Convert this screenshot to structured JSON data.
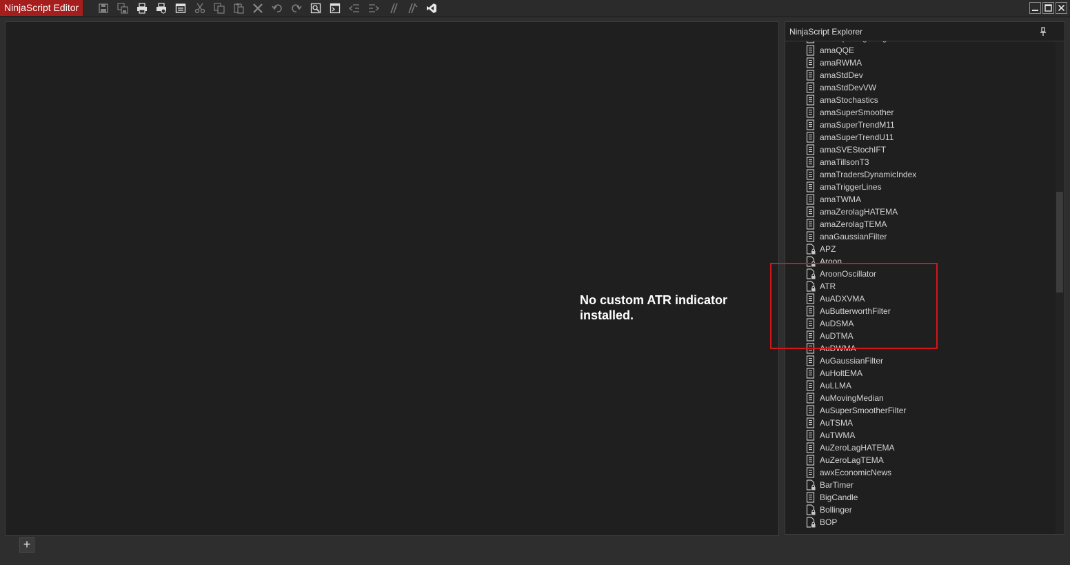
{
  "window": {
    "title": "NinjaScript Editor"
  },
  "toolbar": {
    "buttons": [
      {
        "name": "save-icon",
        "enabled": false
      },
      {
        "name": "save-all-icon",
        "enabled": false
      },
      {
        "name": "print-icon",
        "enabled": true
      },
      {
        "name": "print-preview-icon",
        "enabled": true
      },
      {
        "name": "properties-icon",
        "enabled": true
      },
      {
        "name": "cut-icon",
        "enabled": false
      },
      {
        "name": "copy-icon",
        "enabled": false
      },
      {
        "name": "paste-icon",
        "enabled": false
      },
      {
        "name": "delete-icon",
        "enabled": false
      },
      {
        "name": "undo-icon",
        "enabled": false
      },
      {
        "name": "redo-icon",
        "enabled": false
      },
      {
        "name": "find-icon",
        "enabled": true
      },
      {
        "name": "compile-icon",
        "enabled": true
      },
      {
        "name": "outdent-icon",
        "enabled": false
      },
      {
        "name": "indent-icon",
        "enabled": false
      },
      {
        "name": "comment-icon",
        "enabled": false
      },
      {
        "name": "uncomment-icon",
        "enabled": false
      },
      {
        "name": "visual-studio-icon",
        "enabled": true
      }
    ]
  },
  "annotation": {
    "text": "No custom ATR indicator installed."
  },
  "explorer": {
    "title": "NinjaScript Explorer",
    "items": [
      {
        "label": "amaOpeningRange",
        "locked": false
      },
      {
        "label": "amaQQE",
        "locked": false
      },
      {
        "label": "amaRWMA",
        "locked": false
      },
      {
        "label": "amaStdDev",
        "locked": false
      },
      {
        "label": "amaStdDevVW",
        "locked": false
      },
      {
        "label": "amaStochastics",
        "locked": false
      },
      {
        "label": "amaSuperSmoother",
        "locked": false
      },
      {
        "label": "amaSuperTrendM11",
        "locked": false
      },
      {
        "label": "amaSuperTrendU11",
        "locked": false
      },
      {
        "label": "amaSVEStochIFT",
        "locked": false
      },
      {
        "label": "amaTillsonT3",
        "locked": false
      },
      {
        "label": "amaTradersDynamicIndex",
        "locked": false
      },
      {
        "label": "amaTriggerLines",
        "locked": false
      },
      {
        "label": "amaTWMA",
        "locked": false
      },
      {
        "label": "amaZerolagHATEMA",
        "locked": false
      },
      {
        "label": "amaZerolagTEMA",
        "locked": false
      },
      {
        "label": "anaGaussianFilter",
        "locked": false
      },
      {
        "label": "APZ",
        "locked": true
      },
      {
        "label": "Aroon",
        "locked": true
      },
      {
        "label": "AroonOscillator",
        "locked": true
      },
      {
        "label": "ATR",
        "locked": true
      },
      {
        "label": "AuADXVMA",
        "locked": false
      },
      {
        "label": "AuButterworthFilter",
        "locked": false
      },
      {
        "label": "AuDSMA",
        "locked": false
      },
      {
        "label": "AuDTMA",
        "locked": false
      },
      {
        "label": "AuDWMA",
        "locked": false
      },
      {
        "label": "AuGaussianFilter",
        "locked": false
      },
      {
        "label": "AuHoltEMA",
        "locked": false
      },
      {
        "label": "AuLLMA",
        "locked": false
      },
      {
        "label": "AuMovingMedian",
        "locked": false
      },
      {
        "label": "AuSuperSmootherFilter",
        "locked": false
      },
      {
        "label": "AuTSMA",
        "locked": false
      },
      {
        "label": "AuTWMA",
        "locked": false
      },
      {
        "label": "AuZeroLagHATEMA",
        "locked": false
      },
      {
        "label": "AuZeroLagTEMA",
        "locked": false
      },
      {
        "label": "awxEconomicNews",
        "locked": false
      },
      {
        "label": "BarTimer",
        "locked": true
      },
      {
        "label": "BigCandle",
        "locked": false
      },
      {
        "label": "Bollinger",
        "locked": true
      },
      {
        "label": "BOP",
        "locked": true
      }
    ]
  },
  "colors": {
    "brand": "#a51d1d",
    "highlight": "#d4151a",
    "background": "#2e2e2e",
    "panel": "#1f1f1f"
  }
}
